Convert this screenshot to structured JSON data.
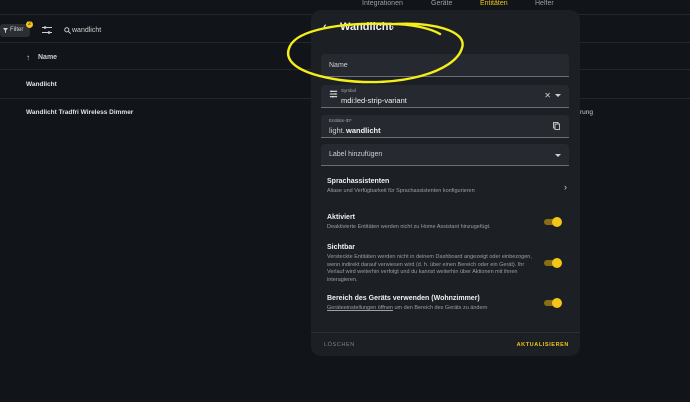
{
  "topnav": {
    "tabs": [
      {
        "label": "Integrationen"
      },
      {
        "label": "Geräte"
      },
      {
        "label": "Entitäten"
      },
      {
        "label": "Helfer"
      }
    ]
  },
  "toolbar": {
    "filter_label": "Filter",
    "filter_count": "2",
    "search_value": "wandlicht"
  },
  "table": {
    "column_name": "Name",
    "rows": [
      {
        "name": "Wandlicht",
        "extra": ""
      },
      {
        "name": "Wandlicht Tradfri Wireless Dimmer",
        "extra": "rung"
      }
    ]
  },
  "dialog": {
    "title": "Wandlicht",
    "name_placeholder": "Name",
    "symbol_label": "Symbol",
    "symbol_value": "mdi:led-strip-variant",
    "entity_id_label": "Entitäts-ID*",
    "entity_id_prefix": "light.",
    "entity_id_suffix": "wandlicht",
    "label_placeholder": "Label hinzufügen",
    "voice": {
      "title": "Sprachassistenten",
      "desc": "Aliase und Verfügbarkeit für Sprachassistenten konfigurieren"
    },
    "enabled": {
      "title": "Aktiviert",
      "desc": "Deaktivierte Entitäten werden nicht zu Home Assistant hinzugefügt.",
      "on": true
    },
    "visible": {
      "title": "Sichtbar",
      "desc": "Versteckte Entitäten werden nicht in deinem Dashboard angezeigt oder einbezogen, wenn indirekt darauf verwiesen wird (d. h. über einen Bereich oder ein Gerät). Ihr Verlauf wird weiterhin verfolgt und du kannst weiterhin über Aktionen mit ihnen interagieren.",
      "on": true
    },
    "area": {
      "title": "Bereich des Geräts verwenden (Wohnzimmer)",
      "link": "Geräteeinstellungen öffnen",
      "desc_rest": " um den Bereich des Geräts zu ändern",
      "on": true
    },
    "delete_label": "LÖSCHEN",
    "update_label": "AKTUALISIEREN"
  },
  "colors": {
    "accent": "#f0c419",
    "background": "#111418",
    "dialog": "#1c1f24",
    "annotation": "#f4ee1a"
  }
}
